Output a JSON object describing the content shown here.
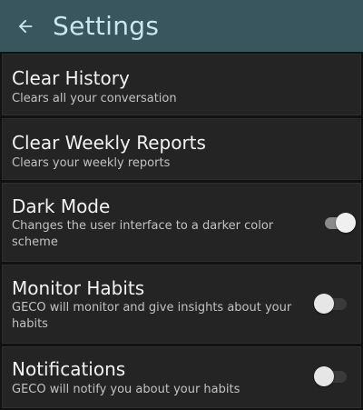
{
  "header": {
    "title": "Settings",
    "back_icon": "arrow-left-icon"
  },
  "colors": {
    "header_bg": "#39555d",
    "header_text": "#c9e8ec",
    "item_bg": "#242424",
    "page_bg": "#111111"
  },
  "settings": {
    "clear_history": {
      "title": "Clear History",
      "description": "Clears all your conversation"
    },
    "clear_weekly_reports": {
      "title": "Clear Weekly Reports",
      "description": "Clears your weekly reports"
    },
    "dark_mode": {
      "title": "Dark Mode",
      "description": "Changes the user interface to a darker color scheme",
      "enabled": true
    },
    "monitor_habits": {
      "title": "Monitor Habits",
      "description": "GECO will monitor and give insights about your habits",
      "enabled": false
    },
    "notifications": {
      "title": "Notifications",
      "description": "GECO will notify you about your habits",
      "enabled": false
    }
  }
}
